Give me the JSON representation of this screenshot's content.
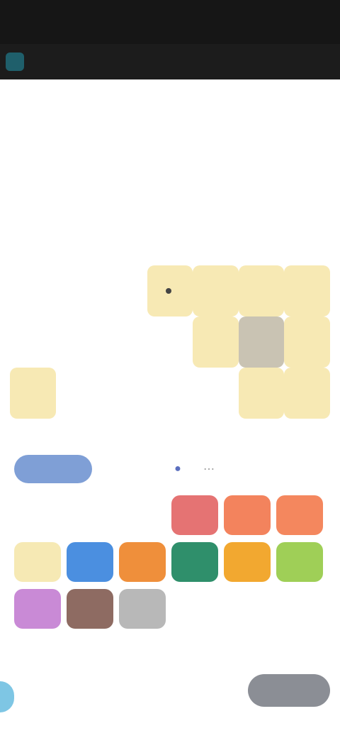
{
  "status_bar": {
    "time": "",
    "right": ""
  },
  "app_bar": {
    "title": ""
  },
  "calendar": {
    "month_label": "",
    "weekdays": [
      "",
      "",
      "",
      "",
      "",
      "",
      ""
    ],
    "days": [
      "",
      "",
      "",
      "",
      "",
      "",
      "",
      "",
      "",
      "",
      "",
      "",
      "",
      "",
      "",
      "",
      "",
      "",
      "",
      "",
      "",
      "",
      "",
      "",
      "",
      "",
      "",
      "",
      "",
      "",
      "",
      "",
      "",
      "",
      ""
    ]
  },
  "hint": "",
  "tabs": [
    {
      "label": ""
    },
    {
      "label": ""
    },
    {
      "label": ""
    }
  ],
  "colors": [
    {
      "name": "empty-1",
      "hex": "#ffffff"
    },
    {
      "name": "empty-2",
      "hex": "#ffffff"
    },
    {
      "name": "empty-3",
      "hex": "#ffffff"
    },
    {
      "name": "red",
      "hex": "#e57373"
    },
    {
      "name": "coral",
      "hex": "#f3835d"
    },
    {
      "name": "orange-red",
      "hex": "#f4875e"
    },
    {
      "name": "pale-yellow",
      "hex": "#f6e9b4"
    },
    {
      "name": "blue",
      "hex": "#4b8fe0"
    },
    {
      "name": "orange",
      "hex": "#ef8f3b"
    },
    {
      "name": "teal-green",
      "hex": "#2f8f6b"
    },
    {
      "name": "amber",
      "hex": "#f2a830"
    },
    {
      "name": "lime",
      "hex": "#9fcf57"
    },
    {
      "name": "purple",
      "hex": "#c98ad6"
    },
    {
      "name": "brown",
      "hex": "#8e6b62"
    },
    {
      "name": "gray",
      "hex": "#b8b8b8"
    }
  ],
  "footer": {
    "text": "",
    "button": ""
  }
}
